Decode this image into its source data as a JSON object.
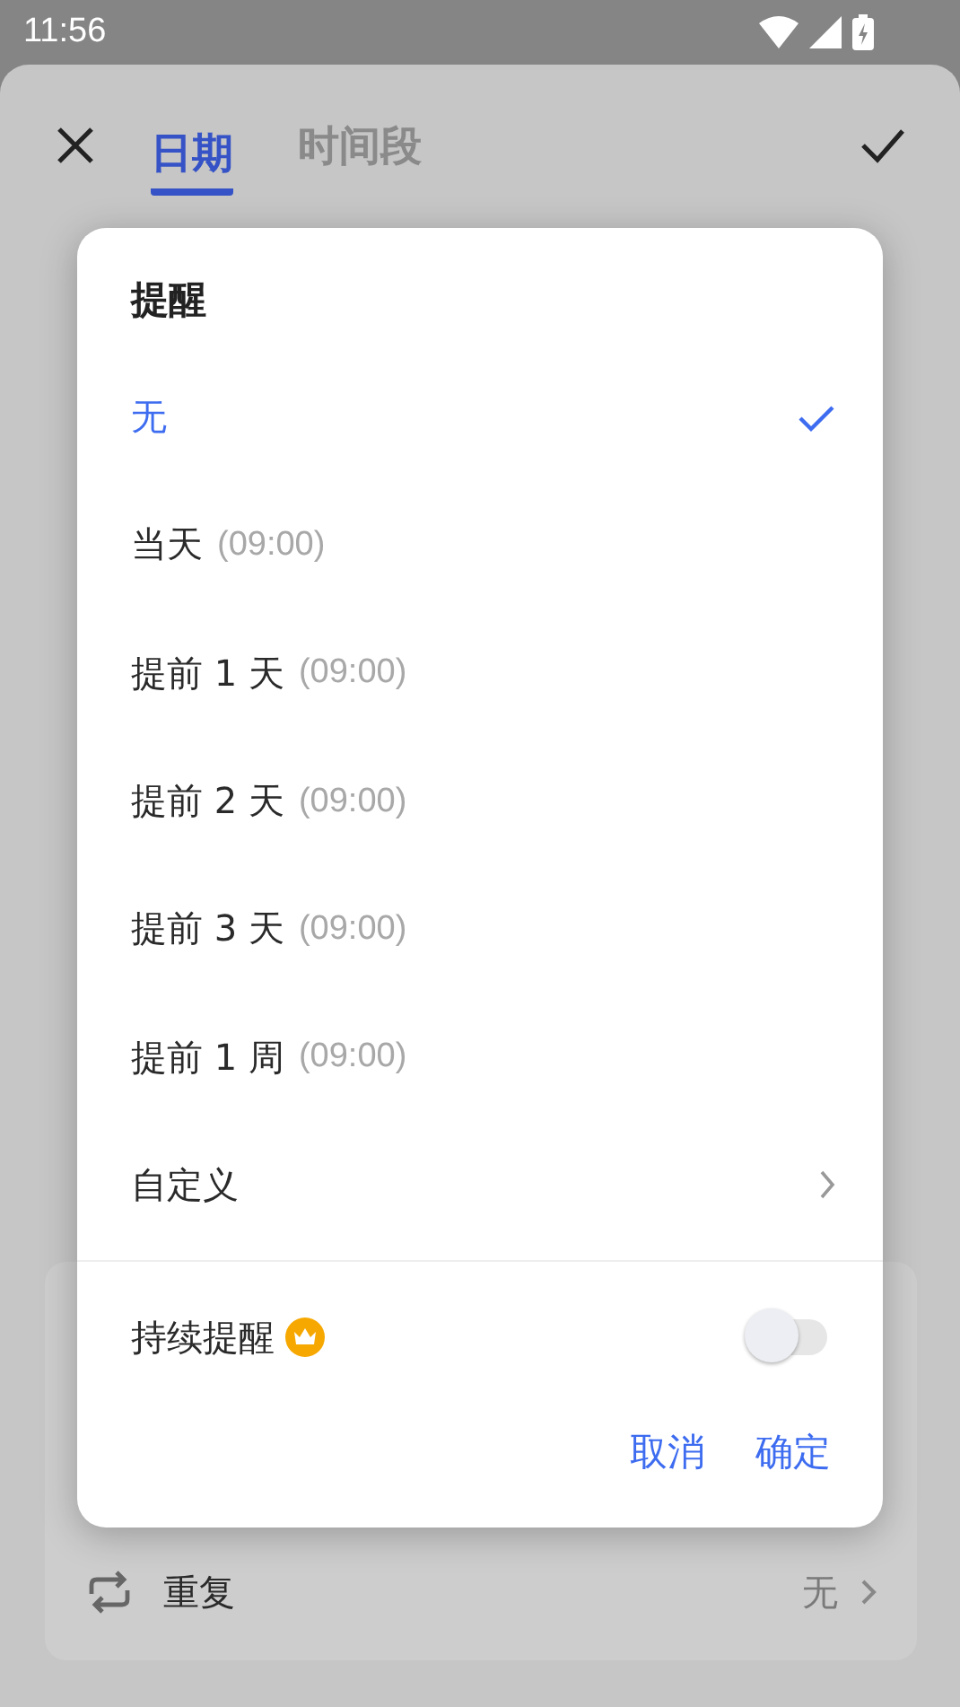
{
  "status_bar": {
    "time": "11:56"
  },
  "header": {
    "tabs": [
      {
        "label": "日期",
        "selected": true
      },
      {
        "label": "时间段",
        "selected": false
      }
    ]
  },
  "repeat_row": {
    "label": "重复",
    "value": "无"
  },
  "dialog": {
    "title": "提醒",
    "options": [
      {
        "kind": "option",
        "label": "无",
        "selected": true
      },
      {
        "kind": "option",
        "label": "当天",
        "time": "(09:00)",
        "selected": false
      },
      {
        "kind": "option",
        "label": "提前 1 天",
        "time": "(09:00)",
        "selected": false
      },
      {
        "kind": "option",
        "label": "提前 2 天",
        "time": "(09:00)",
        "selected": false
      },
      {
        "kind": "option",
        "label": "提前 3 天",
        "time": "(09:00)",
        "selected": false
      },
      {
        "kind": "option",
        "label": "提前 1 周",
        "time": "(09:00)",
        "selected": false
      },
      {
        "kind": "submenu",
        "label": "自定义",
        "selected": false
      }
    ],
    "persistent": {
      "label": "持续提醒",
      "on": false
    },
    "buttons": [
      "取消",
      "确定"
    ]
  }
}
